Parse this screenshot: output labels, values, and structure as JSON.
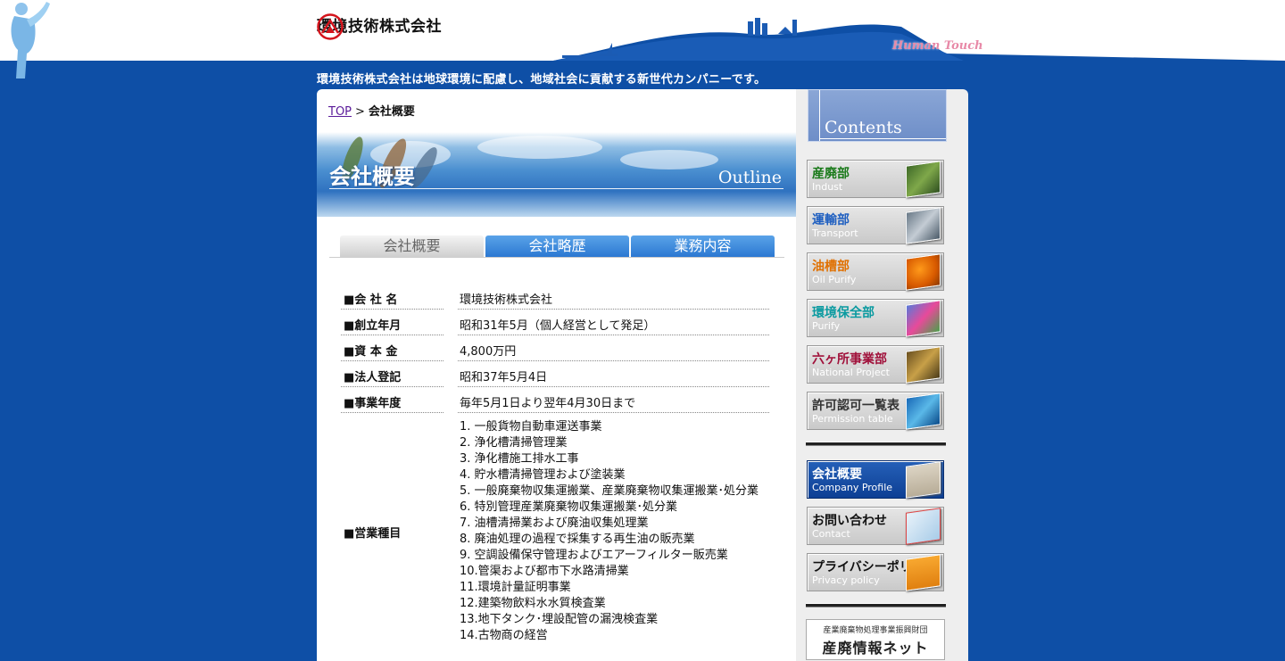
{
  "header": {
    "company_name": "環境技術株式会社",
    "human_touch": "Human Touch",
    "tagline": "環境技術株式会社は地球環境に配慮し、地域社会に貢献する新世代カンパニーです。"
  },
  "breadcrumb": {
    "top": "TOP",
    "separator": ">",
    "current": "会社概要"
  },
  "banner": {
    "title": "会社概要",
    "subtitle": "Outline"
  },
  "tabs": [
    {
      "label": "会社概要"
    },
    {
      "label": "会社略歴"
    },
    {
      "label": "業務内容"
    }
  ],
  "company_info": {
    "rows": [
      {
        "label": "■会 社 名",
        "value": "環境技術株式会社"
      },
      {
        "label": "■創立年月",
        "value": "昭和31年5月（個人経営として発足）"
      },
      {
        "label": "■資 本 金",
        "value": "4,800万円"
      },
      {
        "label": "■法人登記",
        "value": "昭和37年5月4日"
      },
      {
        "label": "■事業年度",
        "value": "毎年5月1日より翌年4月30日まで"
      }
    ],
    "business_label": "■営業種目",
    "business_items": [
      "1. 一般貨物自動車運送事業",
      "2. 浄化槽清掃管理業",
      "3. 浄化槽施工排水工事",
      "4. 貯水槽清掃管理および塗装業",
      "5. 一般廃棄物収集運搬業、産業廃棄物収集運搬業･処分業",
      "6. 特別管理産業廃棄物収集運搬業･処分業",
      "7. 油槽清掃業および廃油収集処理業",
      "8. 廃油処理の過程で採集する再生油の販売業",
      "9. 空調設備保守管理およびエアーフィルター販売業",
      "10.管渠および都市下水路清掃業",
      "11.環境計量証明事業",
      "12.建築物飲料水水質検査業",
      "13.地下タンク･埋設配管の漏洩検査業",
      "14.古物商の経営"
    ]
  },
  "sidebar": {
    "contents_label": "Contents",
    "departments": [
      {
        "jp": "産廃部",
        "en": "Indust",
        "color": "#1a7a1a"
      },
      {
        "jp": "運輸部",
        "en": "Transport",
        "color": "#1f5fc0"
      },
      {
        "jp": "油槽部",
        "en": "Oil Purify",
        "color": "#e07000"
      },
      {
        "jp": "環境保全部",
        "en": "Purify",
        "color": "#0a9aa0"
      },
      {
        "jp": "六ヶ所事業部",
        "en": "National Project",
        "color": "#a0103a"
      },
      {
        "jp": "許可認可一覧表",
        "en": "Permission table",
        "color": "#333333"
      }
    ],
    "info_links": [
      {
        "jp": "会社概要",
        "en": "Company Profile"
      },
      {
        "jp": "お問い合わせ",
        "en": "Contact"
      },
      {
        "jp": "プライバシーポリシー",
        "en": "Privacy policy"
      }
    ],
    "banner_small": "産業廃棄物処理事業振興財団",
    "banner_big": "産廃情報ネット"
  }
}
